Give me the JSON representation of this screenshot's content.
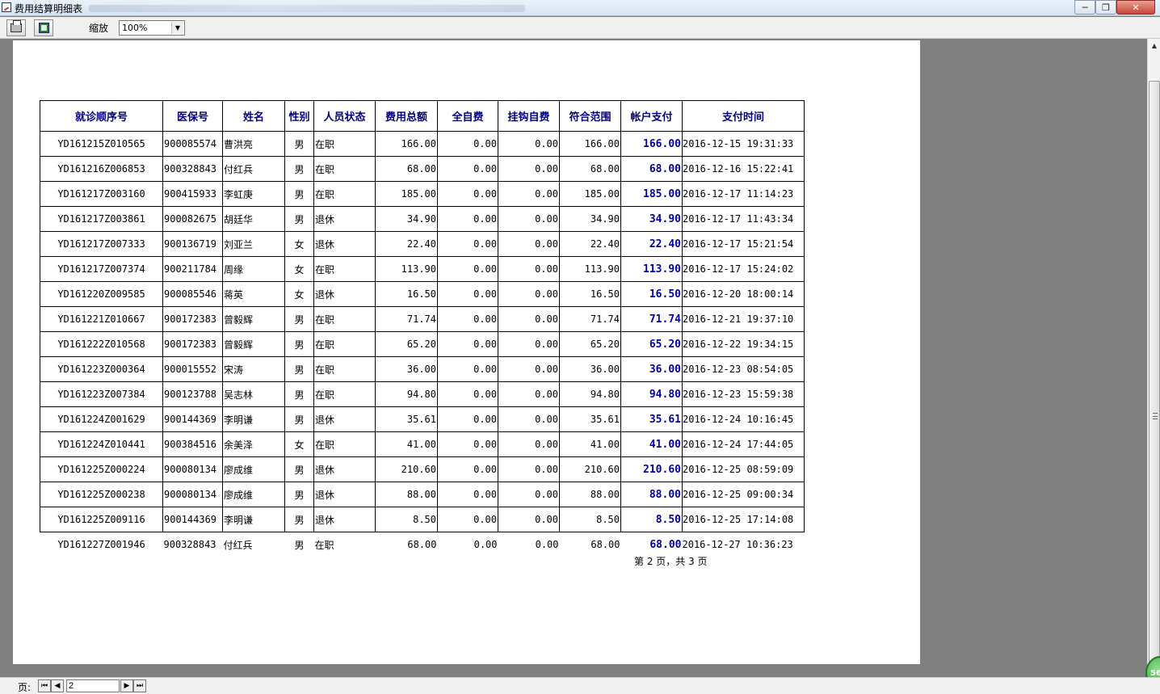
{
  "window": {
    "title": "费用结算明细表",
    "min_glyph": "─",
    "max_glyph": "❐",
    "close_glyph": "✕"
  },
  "toolbar": {
    "print_icon": "printer-icon",
    "export_icon": "export-icon",
    "zoom_label": "缩放",
    "zoom_value": "100%"
  },
  "table": {
    "headers": [
      "就诊顺序号",
      "医保号",
      "姓名",
      "性别",
      "人员状态",
      "费用总额",
      "全自费",
      "挂钩自费",
      "符合范围",
      "帐户支付",
      "支付时间"
    ],
    "rows": [
      [
        "YD161215Z010565",
        "900085574",
        "曹洪亮",
        "男",
        "在职",
        "166.00",
        "0.00",
        "0.00",
        "166.00",
        "166.00",
        "2016-12-15 19:31:33"
      ],
      [
        "YD161216Z006853",
        "900328843",
        "付红兵",
        "男",
        "在职",
        "68.00",
        "0.00",
        "0.00",
        "68.00",
        "68.00",
        "2016-12-16 15:22:41"
      ],
      [
        "YD161217Z003160",
        "900415933",
        "李虹庚",
        "男",
        "在职",
        "185.00",
        "0.00",
        "0.00",
        "185.00",
        "185.00",
        "2016-12-17 11:14:23"
      ],
      [
        "YD161217Z003861",
        "900082675",
        "胡廷华",
        "男",
        "退休",
        "34.90",
        "0.00",
        "0.00",
        "34.90",
        "34.90",
        "2016-12-17 11:43:34"
      ],
      [
        "YD161217Z007333",
        "900136719",
        "刘亚兰",
        "女",
        "退休",
        "22.40",
        "0.00",
        "0.00",
        "22.40",
        "22.40",
        "2016-12-17 15:21:54"
      ],
      [
        "YD161217Z007374",
        "900211784",
        "周缘",
        "女",
        "在职",
        "113.90",
        "0.00",
        "0.00",
        "113.90",
        "113.90",
        "2016-12-17 15:24:02"
      ],
      [
        "YD161220Z009585",
        "900085546",
        "蒋英",
        "女",
        "退休",
        "16.50",
        "0.00",
        "0.00",
        "16.50",
        "16.50",
        "2016-12-20 18:00:14"
      ],
      [
        "YD161221Z010667",
        "900172383",
        "曾毅辉",
        "男",
        "在职",
        "71.74",
        "0.00",
        "0.00",
        "71.74",
        "71.74",
        "2016-12-21 19:37:10"
      ],
      [
        "YD161222Z010568",
        "900172383",
        "曾毅辉",
        "男",
        "在职",
        "65.20",
        "0.00",
        "0.00",
        "65.20",
        "65.20",
        "2016-12-22 19:34:15"
      ],
      [
        "YD161223Z000364",
        "900015552",
        "宋涛",
        "男",
        "在职",
        "36.00",
        "0.00",
        "0.00",
        "36.00",
        "36.00",
        "2016-12-23 08:54:05"
      ],
      [
        "YD161223Z007384",
        "900123788",
        "吴志林",
        "男",
        "在职",
        "94.80",
        "0.00",
        "0.00",
        "94.80",
        "94.80",
        "2016-12-23 15:59:38"
      ],
      [
        "YD161224Z001629",
        "900144369",
        "李明谦",
        "男",
        "退休",
        "35.61",
        "0.00",
        "0.00",
        "35.61",
        "35.61",
        "2016-12-24 10:16:45"
      ],
      [
        "YD161224Z010441",
        "900384516",
        "余美泽",
        "女",
        "在职",
        "41.00",
        "0.00",
        "0.00",
        "41.00",
        "41.00",
        "2016-12-24 17:44:05"
      ],
      [
        "YD161225Z000224",
        "900080134",
        "廖成维",
        "男",
        "退休",
        "210.60",
        "0.00",
        "0.00",
        "210.60",
        "210.60",
        "2016-12-25 08:59:09"
      ],
      [
        "YD161225Z000238",
        "900080134",
        "廖成维",
        "男",
        "退休",
        "88.00",
        "0.00",
        "0.00",
        "88.00",
        "88.00",
        "2016-12-25 09:00:34"
      ],
      [
        "YD161225Z009116",
        "900144369",
        "李明谦",
        "男",
        "退休",
        "8.50",
        "0.00",
        "0.00",
        "8.50",
        "8.50",
        "2016-12-25 17:14:08"
      ]
    ],
    "last_row": [
      "YD161227Z001946",
      "900328843",
      "付红兵",
      "男",
      "在职",
      "68.00",
      "0.00",
      "0.00",
      "68.00",
      "68.00",
      "2016-12-27 10:36:23"
    ]
  },
  "footer": {
    "page_text": "第 2 页，共 3 页"
  },
  "pager": {
    "label": "页:",
    "current_page": "2",
    "first_glyph": "⏮",
    "prev_glyph": "◀",
    "next_glyph": "▶",
    "last_glyph": "⏭"
  },
  "badge": {
    "text": "56"
  },
  "colors": {
    "header_text": "#000080",
    "account_text": "#0000a0",
    "workspace": "#808080"
  }
}
